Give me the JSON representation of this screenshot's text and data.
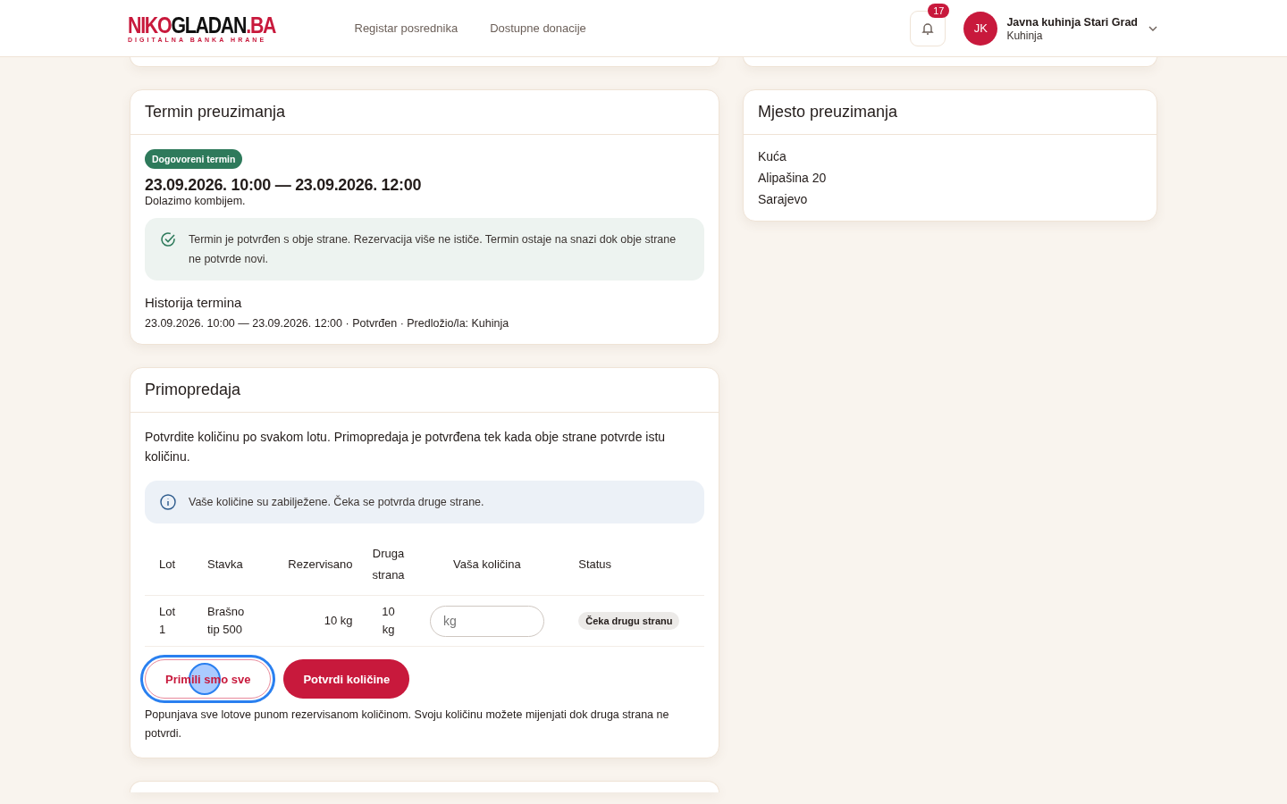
{
  "header": {
    "logo": {
      "parts": [
        {
          "text": "NIKO",
          "kind": "accent"
        },
        {
          "text": "GLADAN",
          "kind": "plain"
        },
        {
          "text": ".BA",
          "kind": "accent"
        }
      ],
      "tagline": "DIGITALNA BANKA HRANE"
    },
    "nav": [
      {
        "label": "Registar posrednika"
      },
      {
        "label": "Dostupne donacije"
      }
    ],
    "notifications": {
      "count": "17"
    },
    "user": {
      "initials": "JK",
      "name": "Javna kuhinja Stari Grad",
      "role": "Kuhinja"
    }
  },
  "termin": {
    "title": "Termin preuzimanja",
    "badge": "Dogovoreni termin",
    "range": "23.09.2026. 10:00 — 23.09.2026. 12:00",
    "note": "Dolazimo kombijem.",
    "alert": {
      "kind": "success",
      "text": "Termin je potvrđen s obje strane. Rezervacija više ne ističe. Termin ostaje na snazi dok obje strane ne potvrde novi."
    },
    "history_title": "Historija termina",
    "history": [
      "23.09.2026. 10:00 — 23.09.2026. 12:00 · Potvrđen · Predložio/la: Kuhinja"
    ]
  },
  "mjesto": {
    "title": "Mjesto preuzimanja",
    "lines": [
      "Kuća",
      "Alipašina 20",
      "Sarajevo"
    ]
  },
  "primopredaja": {
    "title": "Primopredaja",
    "intro": "Potvrdite količinu po svakom lotu. Primopredaja je potvrđena tek kada obje strane potvrde istu količinu.",
    "alert": {
      "kind": "info",
      "text": "Vaše količine su zabilježene. Čeka se potvrda druge strane."
    },
    "table": {
      "columns": [
        "Lot",
        "Stavka",
        "Rezervisano",
        "Druga strana",
        "Vaša količina",
        "Status"
      ],
      "rows": [
        {
          "lot": "Lot 1",
          "item": "Brašno tip 500",
          "reserved": "10 kg",
          "other": "10 kg",
          "placeholder": "kg",
          "status": "Čeka drugu stranu"
        }
      ]
    },
    "buttons": [
      {
        "label": "Primili smo sve",
        "kind": "outline",
        "focused": true
      },
      {
        "label": "Potvrdi količine",
        "kind": "primary",
        "focused": false
      }
    ],
    "hint": "Popunjava sve lotove punom rezervisanom količinom. Svoju količinu možete mijenjati dok druga strana ne potvrdi."
  }
}
